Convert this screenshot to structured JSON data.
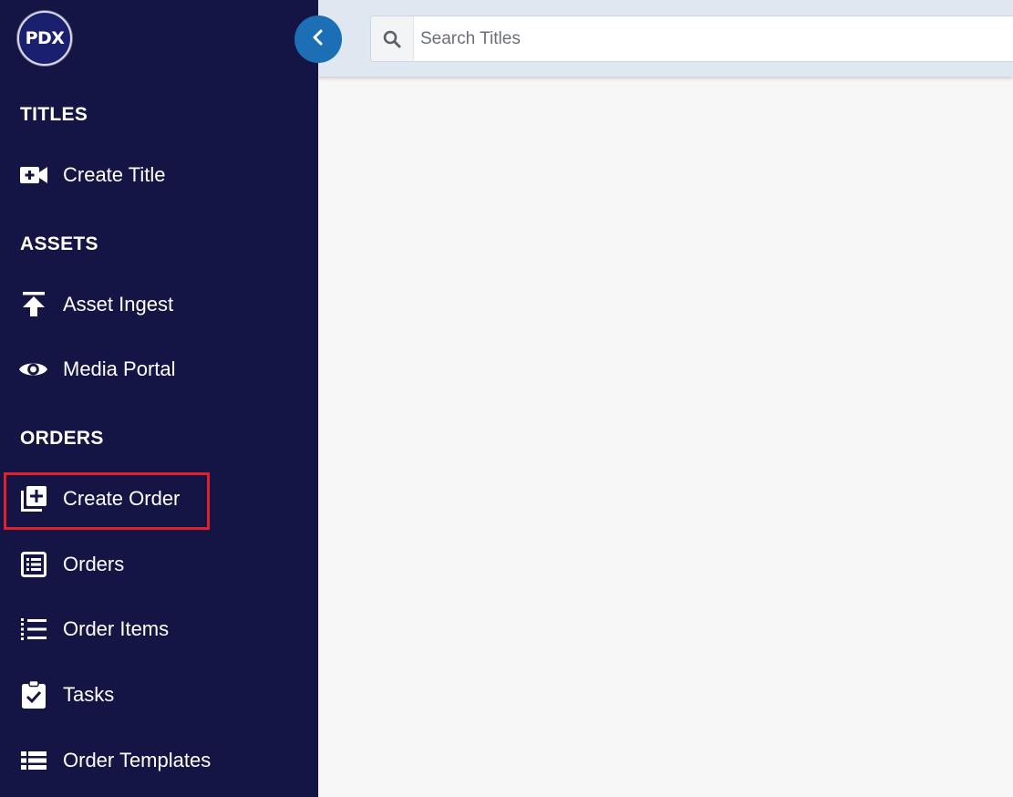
{
  "brand": {
    "logo_text": "PDX"
  },
  "search": {
    "placeholder": "Search Titles",
    "value": ""
  },
  "sidebar": {
    "sections": [
      {
        "title": "TITLES",
        "items": [
          {
            "label": "Create Title",
            "icon": "video-plus-icon"
          }
        ]
      },
      {
        "title": "ASSETS",
        "items": [
          {
            "label": "Asset Ingest",
            "icon": "upload-icon"
          },
          {
            "label": "Media Portal",
            "icon": "eye-icon"
          }
        ]
      },
      {
        "title": "ORDERS",
        "items": [
          {
            "label": "Create Order",
            "icon": "library-add-icon",
            "highlighted": true
          },
          {
            "label": "Orders",
            "icon": "list-box-icon"
          },
          {
            "label": "Order Items",
            "icon": "list-numbered-icon"
          },
          {
            "label": "Tasks",
            "icon": "clipboard-check-icon"
          },
          {
            "label": "Order Templates",
            "icon": "table-list-icon"
          }
        ]
      }
    ]
  },
  "colors": {
    "sidebar_bg": "#141544",
    "topbar_bg": "#dfe7f1",
    "collapse_button": "#1c6fb4",
    "highlight_border": "#e0202c",
    "content_bg": "#f7f7f7"
  }
}
